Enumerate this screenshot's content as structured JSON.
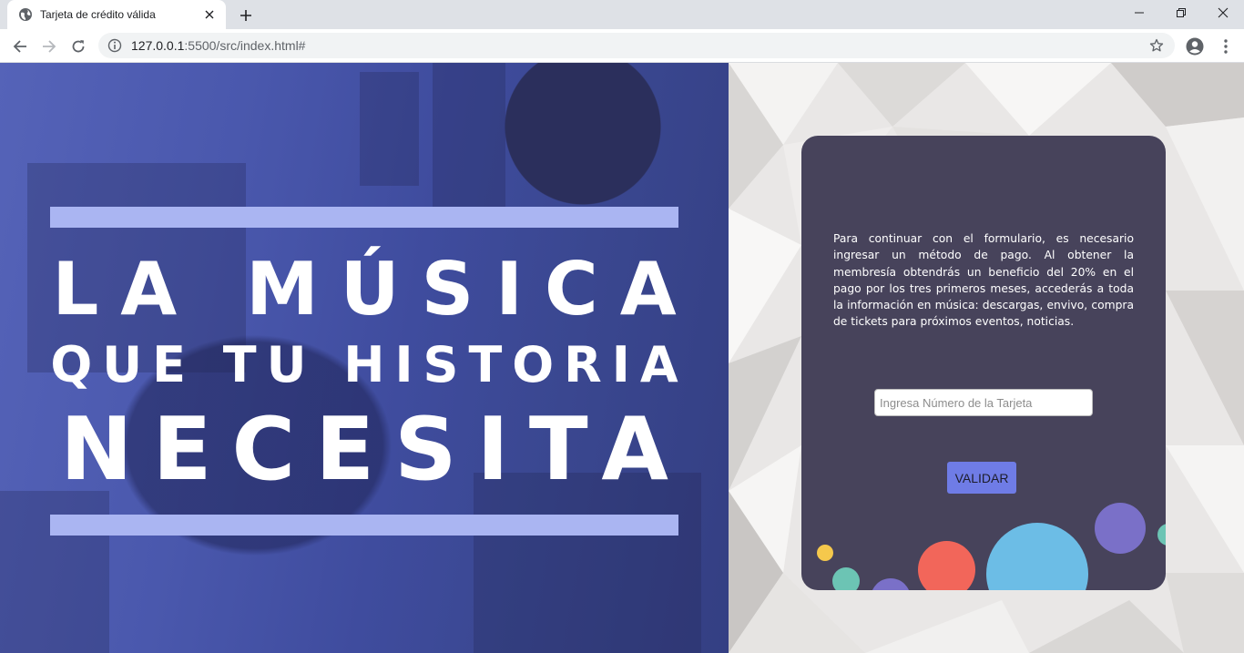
{
  "browser": {
    "tab": {
      "title": "Tarjeta de crédito válida",
      "favicon": "globe-icon"
    },
    "omnibox": {
      "url_host": "127.0.0.1",
      "url_rest": ":5500/src/index.html#"
    },
    "icons": [
      "back-arrow-icon",
      "forward-arrow-icon",
      "reload-icon",
      "info-icon",
      "star-icon",
      "account-icon",
      "more-vert-icon",
      "minimize-icon",
      "restore-icon",
      "close-icon"
    ]
  },
  "hero": {
    "line1": "LA MÚSICA",
    "line2": "QUE TU HISTORIA",
    "line3": "NECESITA",
    "bar_color": "#aab5f2"
  },
  "card": {
    "description": "Para continuar con el formulario, es necesario ingresar un método de pago. Al obtener la membresía obtendrás un beneficio del 20% en el pago por los tres primeros meses, accederás a toda la información en música: descargas, envivo, compra de tickets para próximos eventos, noticias.",
    "card_input": {
      "placeholder": "Ingresa Número de la Tarjeta",
      "value": ""
    },
    "validate_label": "VALIDAR",
    "background": "#47435b",
    "button_color": "#6f7ce6",
    "bubble_colors": [
      "#f5c84c",
      "#6cc4b4",
      "#7a70c8",
      "#f2665a",
      "#6cbde6"
    ]
  }
}
